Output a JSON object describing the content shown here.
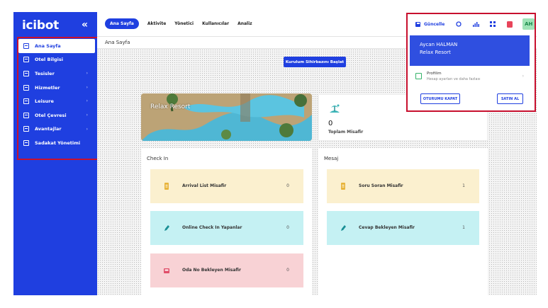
{
  "app": {
    "logo": "icibot",
    "collapse_glyph": "«"
  },
  "sidebar": {
    "items": [
      {
        "label": "Ana Sayfa",
        "active": true
      },
      {
        "label": "Otel Bilgisi"
      },
      {
        "label": "Tesisler"
      },
      {
        "label": "Hizmetler"
      },
      {
        "label": "Leisure"
      },
      {
        "label": "Otel Çevresi"
      },
      {
        "label": "Avantajlar"
      },
      {
        "label": "Sadakat Yönetimi"
      }
    ],
    "chevron": "›"
  },
  "nav": {
    "items": [
      {
        "label": "Ana Sayfa",
        "active": true
      },
      {
        "label": "Aktivite"
      },
      {
        "label": "Yönetici"
      },
      {
        "label": "Kullanıcılar"
      },
      {
        "label": "Analiz"
      }
    ]
  },
  "breadcrumb": "Ana Sayfa",
  "wizard_button": "Kurulum Sihirbazını Başlat",
  "hotel_card": {
    "label": "Relax Resort"
  },
  "stat_card": {
    "value": "0",
    "label": "Toplam Misafir"
  },
  "checkin": {
    "title": "Check In",
    "tiles": [
      {
        "label": "Arrival List Misafir",
        "count": "0"
      },
      {
        "label": "Online Check In Yapanlar",
        "count": "0"
      },
      {
        "label": "Oda No Bekleyen Misafir",
        "count": "0"
      }
    ]
  },
  "message": {
    "title": "Mesaj",
    "tiles": [
      {
        "label": "Soru Soran Misafir",
        "count": "1"
      },
      {
        "label": "Cevap Bekleyen Misafir",
        "count": "1"
      }
    ]
  },
  "profile_menu": {
    "update_label": "Güncelle",
    "avatar_initials": "AH",
    "user_name": "Aycan HALMAN",
    "user_hotel": "Relax Resort",
    "profile_title": "Profilim",
    "profile_desc": "Hesap ayarları ve daha fazlası",
    "chevron": "›",
    "logout_label": "OTURUMU KAPAT",
    "buy_label": "SATIN AL"
  },
  "colors": {
    "primary": "#1f3fe0",
    "highlight_border": "#c8102e",
    "tile_yellow": "#fbf0cf",
    "tile_cyan": "#c5f1f3",
    "tile_pink": "#f8d2d5"
  }
}
